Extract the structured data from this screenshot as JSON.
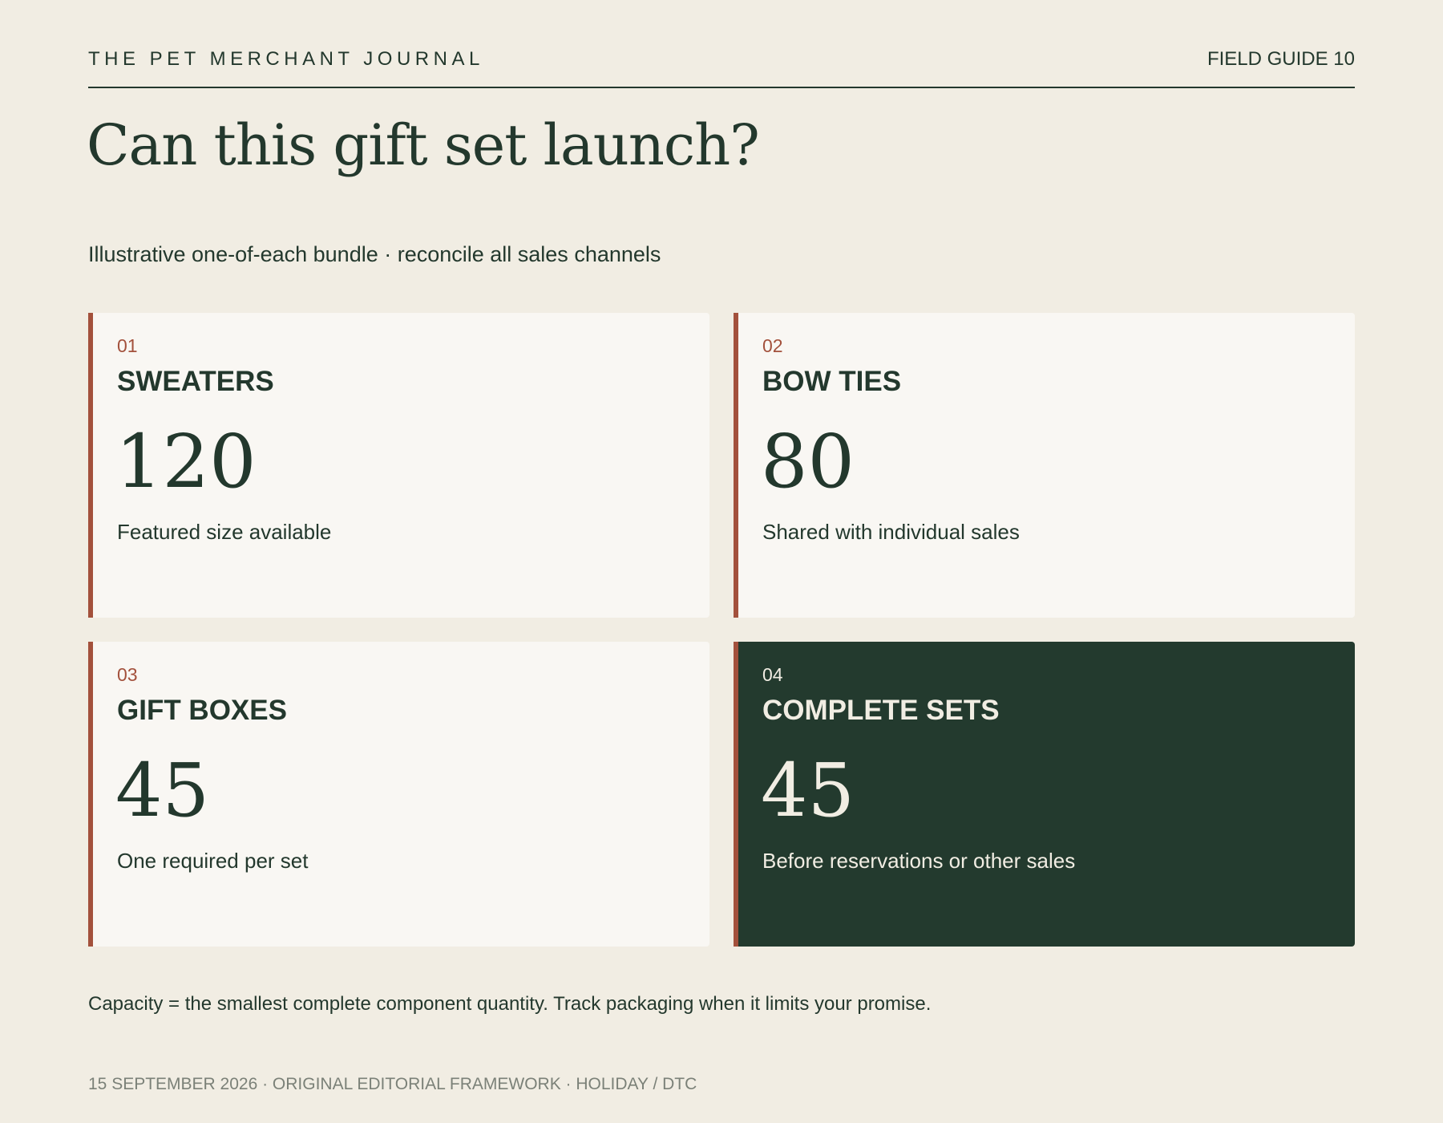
{
  "header": {
    "journal": "THE PET MERCHANT JOURNAL",
    "issue": "FIELD GUIDE 10"
  },
  "title": "Can this gift set launch?",
  "subtitle": "Illustrative one-of-each bundle · reconcile all sales channels",
  "cards": [
    {
      "num": "01",
      "label": "SWEATERS",
      "value": "120",
      "note": "Featured size available"
    },
    {
      "num": "02",
      "label": "BOW TIES",
      "value": "80",
      "note": "Shared with individual sales"
    },
    {
      "num": "03",
      "label": "GIFT BOXES",
      "value": "45",
      "note": "One required per set"
    },
    {
      "num": "04",
      "label": "COMPLETE SETS",
      "value": "45",
      "note": "Before reservations or other sales"
    }
  ],
  "footnote": "Capacity = the smallest complete component quantity. Track packaging when it limits your promise.",
  "footer": "15 SEPTEMBER 2026 · ORIGINAL EDITORIAL FRAMEWORK · HOLIDAY / DTC",
  "colors": {
    "background": "#f1ede3",
    "card": "#f9f7f3",
    "ink": "#23382d",
    "accent": "#a3513c",
    "highlight_card": "#233a2e",
    "muted": "#7b8178"
  }
}
